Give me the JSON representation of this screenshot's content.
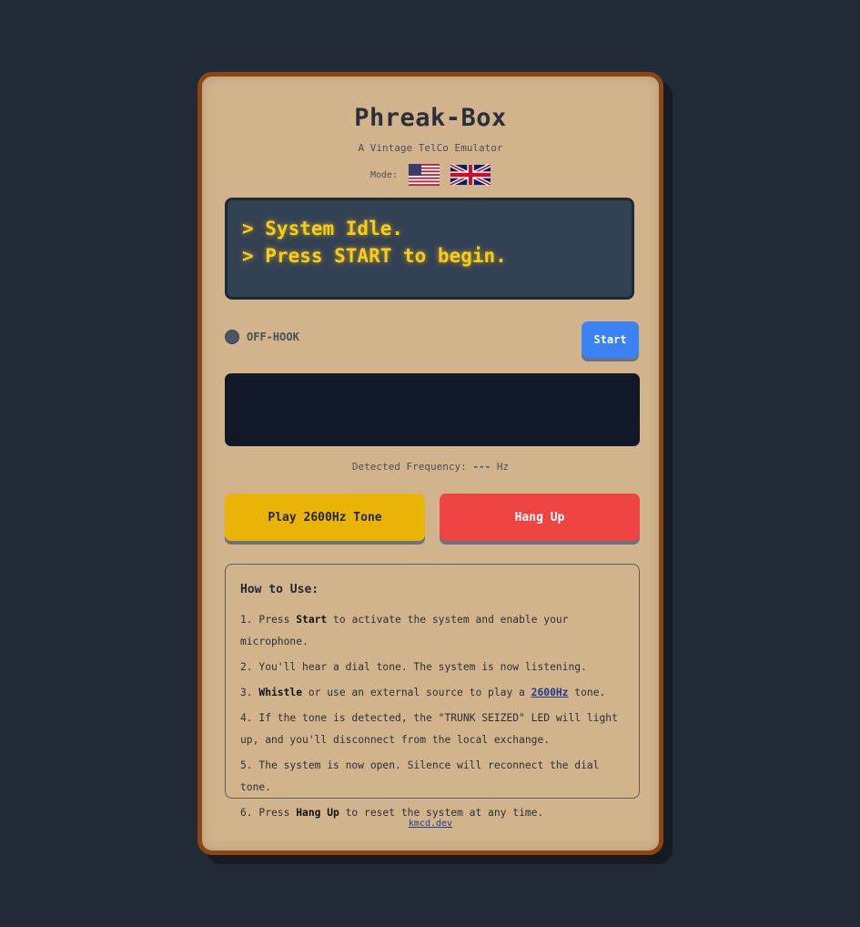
{
  "app": {
    "title": "Phreak-Box",
    "subtitle": "A Vintage TelCo Emulator",
    "mode_label": "Mode:"
  },
  "modes": [
    {
      "name": "us-flag-icon",
      "label": "US"
    },
    {
      "name": "uk-flag-icon",
      "label": "UK"
    }
  ],
  "screen": {
    "lines": [
      "> System Idle.",
      "> Press START to begin."
    ]
  },
  "status": {
    "led_label": "OFF-HOOK",
    "start_label": "Start"
  },
  "frequency": {
    "label": "Detected Frequency:",
    "value": "---",
    "unit": "Hz"
  },
  "buttons": {
    "tone_label": "Play 2600Hz Tone",
    "hang_label": "Hang Up"
  },
  "howto": {
    "title": "How to Use:",
    "steps": [
      {
        "pre": "1. Press ",
        "bold": "Start",
        "post": " to activate the system and enable your microphone."
      },
      {
        "text": "2. You'll hear a dial tone. The system is now listening."
      },
      {
        "pre": "3. ",
        "bold": "Whistle",
        "mid": " or use an external source to play a ",
        "link": "2600Hz",
        "post": " tone."
      },
      {
        "text": "4. If the tone is detected, the \"TRUNK SEIZED\" LED will light up, and you'll disconnect from the local exchange."
      },
      {
        "text": "5. The system is now open. Silence will reconnect the dial tone."
      },
      {
        "pre": "6. Press ",
        "bold": "Hang Up",
        "post": " to reset the system at any time."
      }
    ]
  },
  "footer": {
    "link": "kmcd.dev"
  },
  "colors": {
    "panel": "#d2b48c",
    "border": "#8b4513",
    "screen_text": "#facc15",
    "start": "#3b82f6",
    "tone": "#eab308",
    "hang": "#ef4444"
  }
}
